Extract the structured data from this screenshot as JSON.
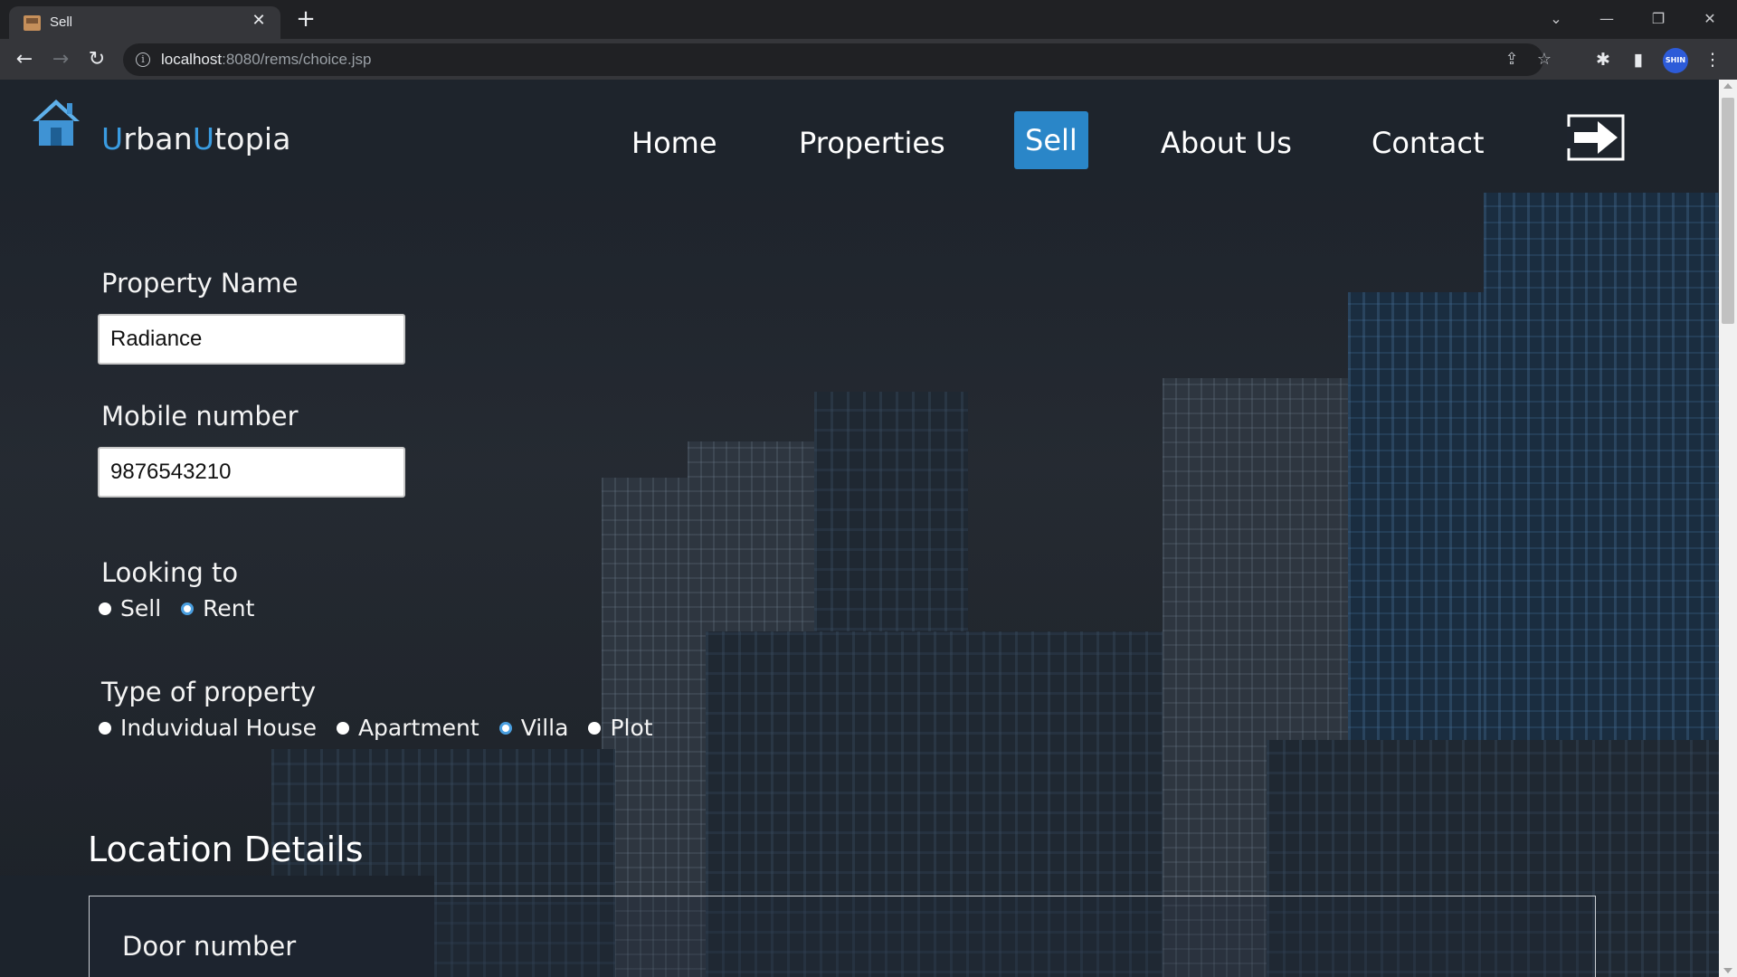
{
  "browser": {
    "tab_title": "Sell",
    "url_host": "localhost",
    "url_path": ":8080/rems/choice.jsp",
    "profile_label": "SHIN"
  },
  "site": {
    "brand_first_letter": "U",
    "brand_first_rest": "rban",
    "brand_second_letter": "U",
    "brand_second_rest": "topia",
    "nav": [
      {
        "label": "Home",
        "active": false
      },
      {
        "label": "Properties",
        "active": false
      },
      {
        "label": "Sell",
        "active": true
      },
      {
        "label": "About Us",
        "active": false
      },
      {
        "label": "Contact",
        "active": false
      }
    ],
    "accent_color": "#2a86c8"
  },
  "form": {
    "property_name_label": "Property Name",
    "property_name_value": "Radiance",
    "mobile_label": "Mobile number",
    "mobile_value": "9876543210",
    "looking_to_label": "Looking to",
    "looking_to_options": [
      {
        "label": "Sell",
        "checked": false
      },
      {
        "label": "Rent",
        "checked": true
      }
    ],
    "type_label": "Type of property",
    "type_options": [
      {
        "label": "Induvidual House",
        "checked": false
      },
      {
        "label": "Apartment",
        "checked": false
      },
      {
        "label": "Villa",
        "checked": true
      },
      {
        "label": "Plot",
        "checked": false
      }
    ]
  },
  "location": {
    "section_title": "Location Details",
    "door_number_label": "Door number"
  }
}
